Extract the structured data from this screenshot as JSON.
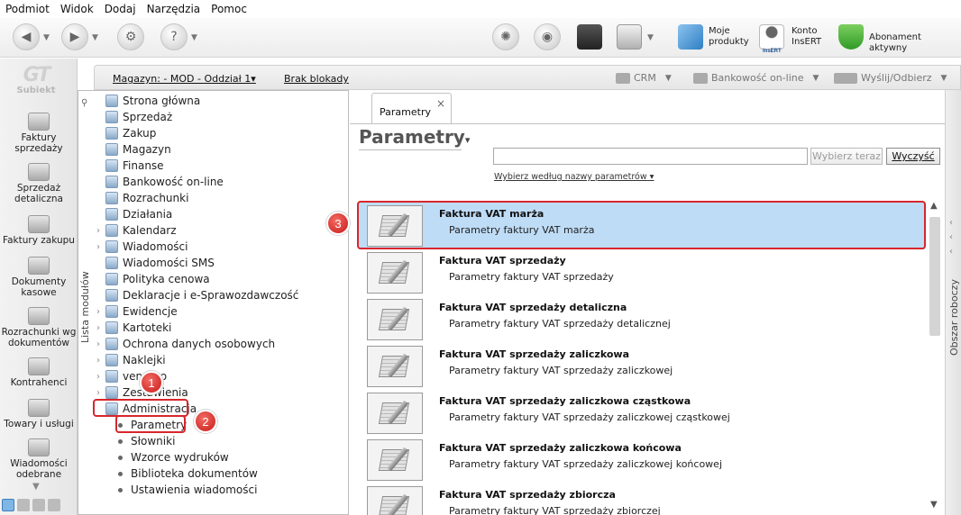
{
  "menu": [
    "Podmiot",
    "Widok",
    "Dodaj",
    "Narzędzia",
    "Pomoc"
  ],
  "toolbar": {
    "my_products": [
      "Moje",
      "produkty"
    ],
    "account": [
      "Konto",
      "InsERT"
    ],
    "subscription": "Abonament aktywny",
    "account_logo_text": "InsERT"
  },
  "logo": "Subiekt",
  "leftnav": [
    [
      "Faktury",
      "sprzedaży"
    ],
    [
      "Sprzedaż",
      "detaliczna"
    ],
    [
      "Faktury zakupu"
    ],
    [
      "Dokumenty",
      "kasowe"
    ],
    [
      "Rozrachunki wg",
      "dokumentów"
    ],
    [
      "Kontrahenci"
    ],
    [
      "Towary i usługi"
    ],
    [
      "Wiadomości",
      "odebrane"
    ]
  ],
  "strip": {
    "warehouse": "Magazyn: - MOD - Oddział 1",
    "caret": "▾",
    "no_locks": "Brak blokady",
    "crm": "CRM",
    "banking": "Bankowość on-line",
    "send_receive": "Wyślij/Odbierz"
  },
  "tree": {
    "vertical_label": "Lista modułów",
    "items": [
      "Strona główna",
      "Sprzedaż",
      "Zakup",
      "Magazyn",
      "Finanse",
      "Bankowość on-line",
      "Rozrachunki",
      "Działania",
      "Kalendarz",
      "Wiadomości",
      "Wiadomości SMS",
      "Polityka cenowa",
      "Deklaracje i e-Sprawozdawczość",
      "Ewidencje",
      "Kartoteki",
      "Ochrona danych osobowych",
      "Naklejki",
      "vendero",
      "Zestawienia",
      "Administracja"
    ],
    "sub_items": [
      "Parametry",
      "Słowniki",
      "Wzorce wydruków",
      "Biblioteka dokumentów",
      "Ustawienia wiadomości"
    ]
  },
  "badges": [
    "1",
    "2",
    "3"
  ],
  "content": {
    "tab_label": "Parametry",
    "tab_close": "×",
    "page_title": "Parametry",
    "search_value": "",
    "select_button": "Wybierz teraz",
    "clear_button": "Wyczyść",
    "select_by": "Wybierz według nazwy parametrów"
  },
  "params": [
    {
      "title": "Faktura VAT marża",
      "desc": "Parametry faktury VAT marża"
    },
    {
      "title": "Faktura VAT sprzedaży",
      "desc": "Parametry faktury VAT sprzedaży"
    },
    {
      "title": "Faktura VAT sprzedaży detaliczna",
      "desc": "Parametry faktury VAT sprzedaży detalicznej"
    },
    {
      "title": "Faktura VAT sprzedaży zaliczkowa",
      "desc": "Parametry faktury VAT sprzedaży zaliczkowej"
    },
    {
      "title": "Faktura VAT sprzedaży zaliczkowa cząstkowa",
      "desc": "Parametry faktury VAT sprzedaży zaliczkowej cząstkowej"
    },
    {
      "title": "Faktura VAT sprzedaży zaliczkowa końcowa",
      "desc": "Parametry faktury VAT sprzedaży zaliczkowej końcowej"
    },
    {
      "title": "Faktura VAT sprzedaży zbiorcza",
      "desc": "Parametry faktury VAT sprzedaży zbiorczej"
    }
  ],
  "right_rail": "Obszar roboczy",
  "colors": {
    "selection": "#bfdcf6",
    "highlight": "#d8262c",
    "badge": "#d42a25"
  },
  "icons": [
    "back-icon",
    "forward-icon",
    "tools-icon",
    "help-icon",
    "spinner-icon",
    "globe-icon",
    "cube-icon",
    "cloud-icon",
    "products-icon",
    "account-icon",
    "shield-check-icon"
  ]
}
